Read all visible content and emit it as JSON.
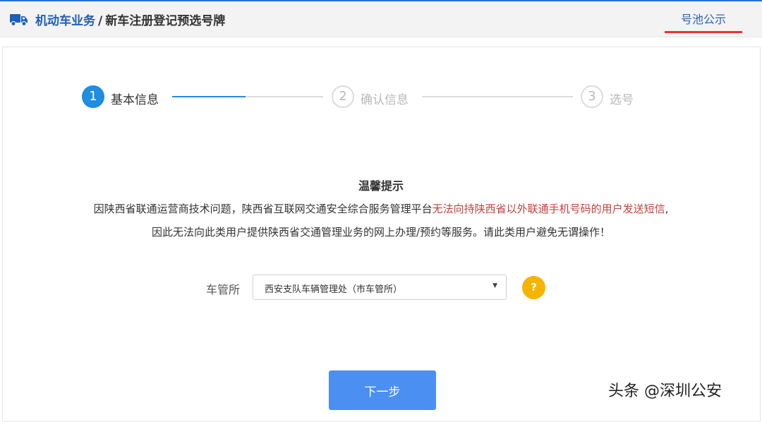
{
  "header": {
    "breadcrumb_main": "机动车业务",
    "breadcrumb_sep": "/",
    "breadcrumb_sub": "新车注册登记预选号牌",
    "pool_link": "号池公示"
  },
  "steps": [
    {
      "number": "1",
      "label": "基本信息"
    },
    {
      "number": "2",
      "label": "确认信息"
    },
    {
      "number": "3",
      "label": "选号"
    }
  ],
  "notice": {
    "title": "温馨提示",
    "line1_prefix": "因陕西省联通运营商技术问题，陕西省互联网交通安全综合服务管理平台",
    "line1_warning": "无法向持陕西省以外联通手机号码的用户发送短信",
    "line1_suffix": ",",
    "line2": "因此无法向此类用户提供陕西省交通管理业务的网上办理/预约等服务。请此类用户避免无谓操作！"
  },
  "form": {
    "office_label": "车管所",
    "office_value": "西安支队车辆管理处（市车管所）",
    "help_symbol": "?"
  },
  "next_button": "下一步",
  "watermark": "头条 @深圳公安",
  "colors": {
    "accent_blue": "#1f8de0",
    "header_blue": "#1f5fb8",
    "warning_red": "#c0433e",
    "button_blue": "#4a8ff1",
    "help_yellow": "#f6b400",
    "underline_red": "#e5353b"
  }
}
